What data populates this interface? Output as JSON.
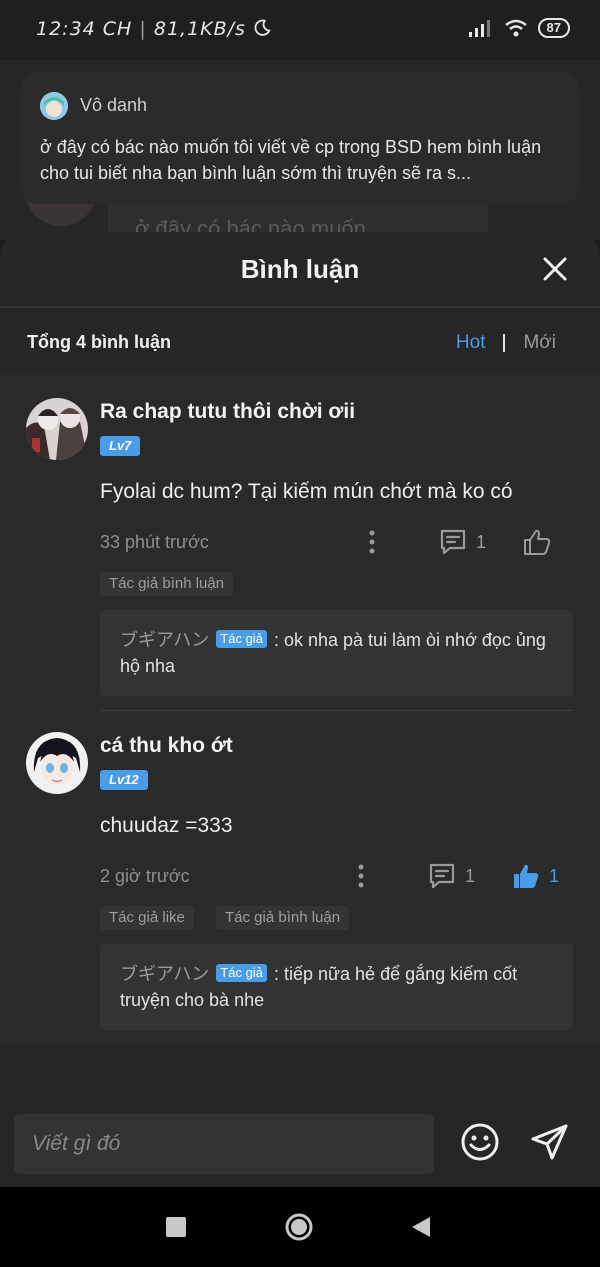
{
  "status_bar": {
    "time": "12:34 CH",
    "speed": "81,1KB/s",
    "battery": "87"
  },
  "background": {
    "peek_text": "ở đây có bác nào muốn"
  },
  "notification": {
    "name": "Vô danh",
    "text": "ở đây có bác nào muốn tôi viết về cp trong BSD hem bình luận cho tui biết nha bạn bình luận sớm thì truyện sẽ ra s..."
  },
  "sheet": {
    "title": "Bình luận",
    "total": "Tổng 4 bình luận",
    "sort_hot": "Hot",
    "sort_new": "Mới"
  },
  "comments": [
    {
      "username": "Ra chap tutu thôi chời ơii",
      "level": "Lv7",
      "text": "Fyolai dc hum? Tại kiếm mún chớt mà ko có",
      "time": "33 phút trước",
      "reply_count": "1",
      "like_count": "",
      "tags": [
        "Tác giả bình luận"
      ],
      "author_reply": {
        "name": "ブギアハン",
        "badge": "Tác giả",
        "text": ": ok nha pà tui làm òi nhớ đọc ủng hộ nha"
      }
    },
    {
      "username": "cá thu kho ớt",
      "level": "Lv12",
      "text": "chuudaz =333",
      "time": "2 giờ trước",
      "reply_count": "1",
      "like_count": "1",
      "tags": [
        "Tác giả like",
        "Tác giả bình luận"
      ],
      "author_reply": {
        "name": "ブギアハン",
        "badge": "Tác giả",
        "text": ": tiếp nữa hẻ để gắng kiếm cốt truyện cho bà nhe"
      }
    }
  ],
  "input": {
    "placeholder": "Viết gì đó"
  },
  "colors": {
    "accent": "#4a9be8",
    "sheet_bg": "#262626",
    "list_bg": "#2a2a2a"
  },
  "icons": [
    "close-icon",
    "more-vertical-icon",
    "comment-icon",
    "thumbs-up-icon",
    "emoji-icon",
    "send-icon",
    "nav-recents-icon",
    "nav-home-icon",
    "nav-back-icon",
    "signal-icon",
    "wifi-icon",
    "moon-icon"
  ]
}
